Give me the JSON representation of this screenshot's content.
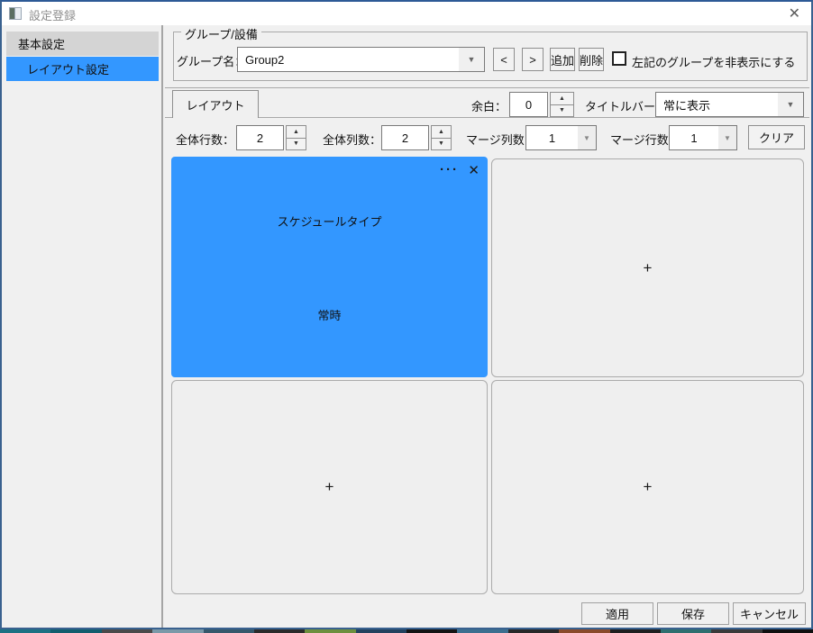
{
  "window": {
    "title": "設定登録"
  },
  "icons": {
    "titlebar_close": "✕",
    "combo_arrow": "▼",
    "spin_up": "▲",
    "spin_down": "▼",
    "cell_menu": "···",
    "cell_close": "✕",
    "plus": "+"
  },
  "sidebar": {
    "items": [
      {
        "label": "基本設定",
        "selected": false
      },
      {
        "label": "レイアウト設定",
        "selected": true
      }
    ]
  },
  "group_section": {
    "box_label": "グループ/設備",
    "group_name_label": "グループ名：",
    "group_name_value": "Group2",
    "prev_label": "<",
    "next_label": ">",
    "add_label": "追加",
    "delete_label": "削除",
    "hide_checkbox_label": "左記のグループを非表示にする",
    "hide_checkbox_checked": false
  },
  "layout_section": {
    "tab_label": "レイアウト",
    "margin_label": "余白：",
    "margin_value": "0",
    "titlebar_label": "タイトルバー：",
    "titlebar_value": "常に表示",
    "rows_label": "全体行数：",
    "rows_value": "2",
    "cols_label": "全体列数：",
    "cols_value": "2",
    "merge_cols_label": "マージ列数：",
    "merge_cols_value": "1",
    "merge_rows_label": "マージ行数：",
    "merge_rows_value": "1",
    "clear_label": "クリア"
  },
  "grid": {
    "active_cell": {
      "line1": "スケジュールタイプ",
      "line2": "常時",
      "color": "#3397ff"
    },
    "empty_cell_symbol": "+"
  },
  "footer": {
    "apply_label": "適用",
    "save_label": "保存",
    "cancel_label": "キャンセル"
  },
  "colors": {
    "accent_blue": "#3397ff",
    "sidebar_item_bg": "#d4d4d4",
    "cell_bg": "#efefef",
    "cell_border": "#ababab",
    "window_border": "#39618f"
  },
  "desktop_strip": {
    "colors": [
      "#1d7183",
      "#115e6e",
      "#4a4a4a",
      "#7a99a8",
      "#35586b",
      "#2b2b2b",
      "#6d8f3e",
      "#23425f",
      "#141414",
      "#3c6f8f",
      "#282828",
      "#8a4a2a",
      "#1f1f1f",
      "#2f6f6f",
      "#3a3a3a",
      "#101010"
    ]
  }
}
